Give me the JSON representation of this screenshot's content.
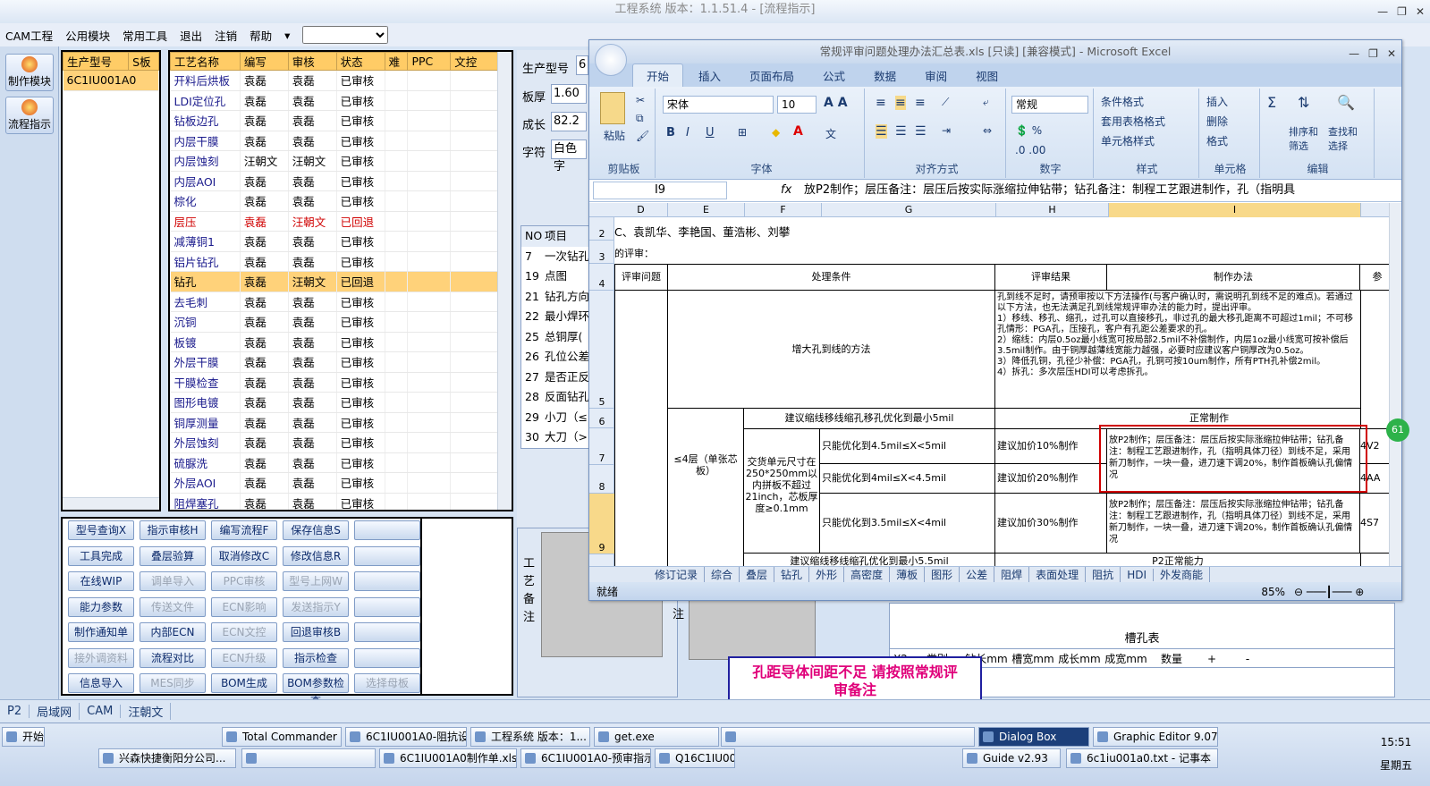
{
  "app_title": "工程系统   版本：1.1.51.4 - [流程指示]",
  "menu": [
    "CAM工程",
    "公用模块",
    "常用工具",
    "退出",
    "注销",
    "帮助"
  ],
  "left_buttons": [
    "制作模块",
    "流程指示"
  ],
  "prod_panel": {
    "headers": [
      "生产型号",
      "S板"
    ],
    "rows": [
      [
        "6C1IU001A0",
        ""
      ]
    ]
  },
  "proc_panel": {
    "headers": [
      "工艺名称",
      "编写",
      "审核",
      "状态",
      "难",
      "PPC",
      "文控"
    ],
    "rows": [
      [
        "开料后烘板",
        "袁磊",
        "袁磊",
        "已审核"
      ],
      [
        "LDI定位孔",
        "袁磊",
        "袁磊",
        "已审核"
      ],
      [
        "钻板边孔",
        "袁磊",
        "袁磊",
        "已审核"
      ],
      [
        "内层干膜",
        "袁磊",
        "袁磊",
        "已审核"
      ],
      [
        "内层蚀刻",
        "汪朝文",
        "汪朝文",
        "已审核"
      ],
      [
        "内层AOI",
        "袁磊",
        "袁磊",
        "已审核"
      ],
      [
        "棕化",
        "袁磊",
        "袁磊",
        "已审核"
      ],
      [
        "层压",
        "袁磊",
        "汪朝文",
        "已回退"
      ],
      [
        "减薄铜1",
        "袁磊",
        "袁磊",
        "已审核"
      ],
      [
        "铝片钻孔",
        "袁磊",
        "袁磊",
        "已审核"
      ],
      [
        "钻孔",
        "袁磊",
        "汪朝文",
        "已回退"
      ],
      [
        "去毛刺",
        "袁磊",
        "袁磊",
        "已审核"
      ],
      [
        "沉铜",
        "袁磊",
        "袁磊",
        "已审核"
      ],
      [
        "板镀",
        "袁磊",
        "袁磊",
        "已审核"
      ],
      [
        "外层干膜",
        "袁磊",
        "袁磊",
        "已审核"
      ],
      [
        "干膜检查",
        "袁磊",
        "袁磊",
        "已审核"
      ],
      [
        "图形电镀",
        "袁磊",
        "袁磊",
        "已审核"
      ],
      [
        "铜厚测量",
        "袁磊",
        "袁磊",
        "已审核"
      ],
      [
        "外层蚀刻",
        "袁磊",
        "袁磊",
        "已审核"
      ],
      [
        "硫脲洗",
        "袁磊",
        "袁磊",
        "已审核"
      ],
      [
        "外层AOI",
        "袁磊",
        "袁磊",
        "已审核"
      ],
      [
        "阻焊塞孔",
        "袁磊",
        "袁磊",
        "已审核"
      ]
    ]
  },
  "action_buttons": [
    [
      "型号查询X",
      "指示审核H",
      "编写流程F",
      "保存信息S",
      ""
    ],
    [
      "工具完成",
      "叠层验算",
      "取消修改C",
      "修改信息R",
      ""
    ],
    [
      "在线WIP",
      "调单导入",
      "PPC审核",
      "型号上网W",
      ""
    ],
    [
      "能力参数",
      "传送文件",
      "ECN影响",
      "发送指示Y",
      ""
    ],
    [
      "制作通知单",
      "内部ECN",
      "ECN文控",
      "回退审核B",
      ""
    ],
    [
      "接外调资料",
      "流程对比",
      "ECN升级",
      "指示检查",
      ""
    ],
    [
      "信息导入",
      "MES同步",
      "BOM生成",
      "BOM参数检查",
      "选择母板"
    ]
  ],
  "mid_fields": [
    {
      "label": "生产型号",
      "value": "6"
    },
    {
      "label": "板厚",
      "value": "1.60"
    },
    {
      "label": "成长",
      "value": "82.2"
    },
    {
      "label": "字符",
      "value": "白色字"
    }
  ],
  "mid_items": [
    [
      "NO",
      "项目"
    ],
    [
      "7",
      "一次钻孔"
    ],
    [
      "19",
      "点图"
    ],
    [
      "21",
      "钻孔方向"
    ],
    [
      "22",
      "最小焊环"
    ],
    [
      "25",
      "总铜厚("
    ],
    [
      "26",
      "孔位公差"
    ],
    [
      "27",
      "是否正反"
    ],
    [
      "28",
      "反面钻孔"
    ],
    [
      "29",
      "小刀（≤"
    ],
    [
      "30",
      "大刀（>"
    ]
  ],
  "excel": {
    "title": "常规评审问题处理办法汇总表.xls  [只读]  [兼容模式] - Microsoft Excel",
    "tabs": [
      "开始",
      "插入",
      "页面布局",
      "公式",
      "数据",
      "审阅",
      "视图"
    ],
    "font_name": "宋体",
    "font_size": "10",
    "number_format": "常规",
    "groups": [
      "剪贴板",
      "字体",
      "对齐方式",
      "数字",
      "样式",
      "单元格",
      "编辑"
    ],
    "ribbon_small": [
      "条件格式",
      "套用表格格式",
      "单元格样式",
      "插入",
      "删除",
      "格式",
      "排序和筛选",
      "查找和选择",
      "粘贴"
    ],
    "cell_ref": "I9",
    "formula": "放P2制作；层压备注：层压后按实际涨缩拉伸钻带；钻孔备注：制程工艺跟进制作，孔（指明具",
    "columns": [
      "D",
      "E",
      "F",
      "G",
      "H",
      "I"
    ],
    "rows": [
      "2",
      "3",
      "4",
      "5",
      "6",
      "7",
      "8",
      "9"
    ],
    "r2": "C、袁凯华、李艳国、董浩彬、刘攀",
    "r3": "的评审：",
    "hdr": [
      "评审问题",
      "处理条件",
      "评审结果",
      "制作办法",
      "参"
    ],
    "r5_cond": "增大孔到线的方法",
    "r5_method": "孔到线不足时，请预审按以下方法操作(与客户确认时，需说明孔到线不足的难点)。若通过以下方法，也无法满足孔到线常规评审办法的能力时，提出评审。\n1）移线、移孔、缩孔，过孔可以直接移孔，非过孔的最大移孔距离不可超过1mil；不可移孔情形：PGA孔，压接孔，客户有孔距公差要求的孔。\n2）缩线：内层0.5oz最小线宽可按局部2.5mil不补偿制作，内层1oz最小线宽可按补偿后3.5mil制作。由于铜厚越薄线宽能力越强，必要时应建议客户铜厚改为0.5oz。\n3）降低孔铜，孔径少补偿：PGA孔，孔铜可按10um制作，所有PTH孔补偿2mil。\n4）拆孔：多次层压HDI可以考虑拆孔。",
    "r6_cond": "建议缩线移线缩孔移孔优化到最小5mil",
    "r6_method": "正常制作",
    "side_e": "≤4层（单张芯板）",
    "side_f": "交货单元尺寸在250*250mm以内拼板不超过21inch，芯板厚度≥0.1mm",
    "g7": "只能优化到4.5mil≤X<5mil",
    "h7": "建议加价10%制作",
    "i7": "放P2制作；层压备注：层压后按实际涨缩拉伸钻带；钻孔备注：制程工艺跟进制作，孔（指明具体刀径）到线不足，采用新刀制作，一块一叠，进刀速下调20%，制作首板确认孔偏情况",
    "g8": "只能优化到4mil≤X<4.5mil",
    "h8": "建议加价20%制作",
    "g9": "只能优化到3.5mil≤X<4mil",
    "h9": "建议加价30%制作",
    "i9": "放P2制作；层压备注：层压后按实际涨缩拉伸钻带；钻孔备注：制程工艺跟进制作，孔（指明具体刀径）到线不足，采用新刀制作，一块一叠，进刀速下调20%，制作首板确认孔偏情况",
    "j7": "4V2",
    "j8": "4AA",
    "j9": "4S7",
    "r10_cond": "建议缩线移线缩孔优化到最小5.5mil",
    "r10_method": "P2正常能力",
    "sheets": [
      "修订记录",
      "综合",
      "叠层",
      "钻孔",
      "外形",
      "高密度",
      "薄板",
      "图形",
      "公差",
      "阻焊",
      "表面处理",
      "阻抗",
      "HDI",
      "外发商能"
    ],
    "status": "就绪",
    "zoom": "85%"
  },
  "slot_table": {
    "title": "槽孔表",
    "headers": [
      "X2",
      "类别",
      "钻长mm",
      "槽宽mm",
      "成长mm",
      "成宽mm",
      "数量",
      "+",
      "-"
    ]
  },
  "note_label": "工艺备注",
  "note_label2": "注",
  "badge": "61",
  "dialog_text": "孔距导体间距不足   请按照常规评审备注",
  "bottom": [
    "P2",
    "局域网",
    "CAM",
    "汪朝文"
  ],
  "taskbar": {
    "start": "开始",
    "row1": [
      "Total Commander 7....",
      "6C1IU001A0-阻抗设...",
      "工程系统  版本：1...",
      "get.exe",
      "",
      "Dialog Box",
      "Graphic Editor 9.07b..."
    ],
    "row2": [
      "兴森快捷衡阳分公司...",
      "",
      "6C1IU001A0制作单.xls ...",
      "6C1IU001A0-预审指示....",
      "Q16C1IU00...",
      "Guide v2.93",
      "6c1iu001a0.txt - 记事本"
    ],
    "time": "15:51",
    "day": "星期五"
  }
}
